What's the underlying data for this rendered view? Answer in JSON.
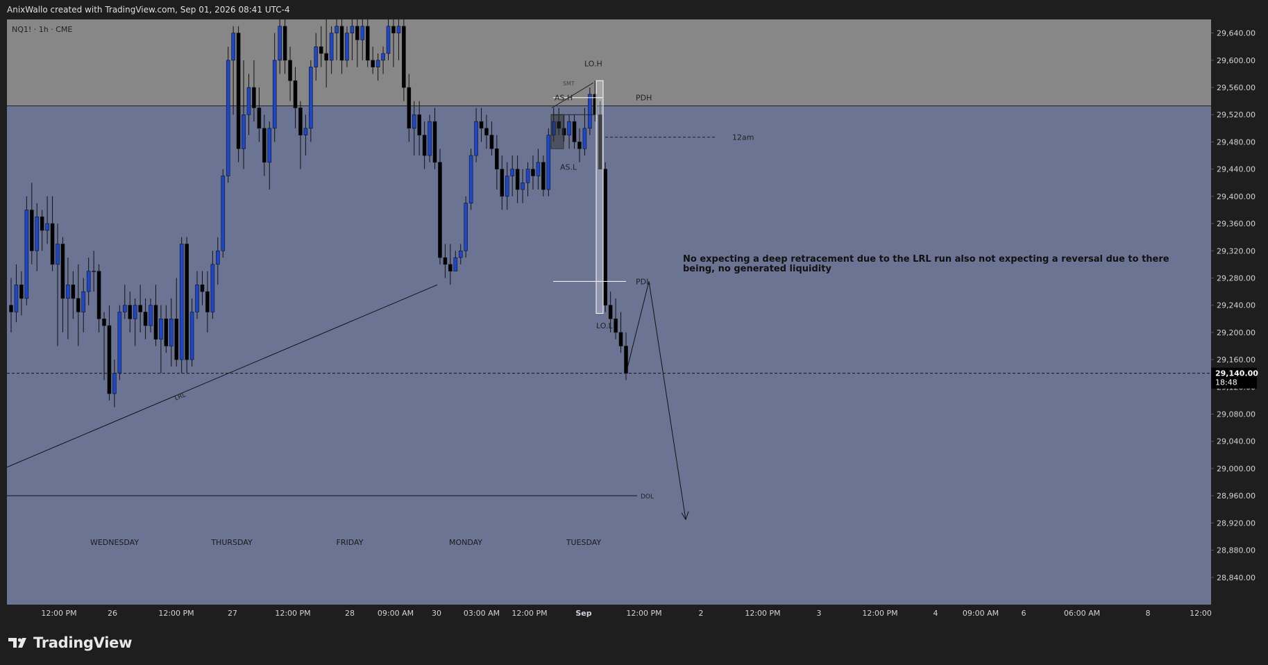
{
  "header": {
    "title": "AnixWallo created with TradingView.com, Sep 01, 2026 08:41 UTC-4"
  },
  "symbol": "NQ1! · 1h · CME",
  "brand": "TradingView",
  "annotation": "No expecting a deep retracement due to the LRL run also not expecting a reversal due to there being, no generated liquidity",
  "colors": {
    "background_pane": "#6b7593",
    "premium_zone": "#878787",
    "candle_up": "#1e46c8",
    "candle_down": "#000000",
    "axis_bg": "#1e1e1e",
    "price_tag": "#000000"
  },
  "chart_data": {
    "type": "candlestick",
    "ylim": [
      28800,
      29660
    ],
    "price_ticks": [
      "29,640.00",
      "29,600.00",
      "29,560.00",
      "29,520.00",
      "29,480.00",
      "29,440.00",
      "29,400.00",
      "29,360.00",
      "29,320.00",
      "29,280.00",
      "29,240.00",
      "29,200.00",
      "29,160.00",
      "29,120.00",
      "29,080.00",
      "29,040.00",
      "29,000.00",
      "28,960.00",
      "28,920.00",
      "28,880.00",
      "28,840.00"
    ],
    "time_ticks": [
      "12:00 PM",
      "26",
      "12:00 PM",
      "27",
      "12:00 PM",
      "28",
      "09:00 AM",
      "30",
      "03:00 AM",
      "12:00 PM",
      "Sep",
      "12:00 PM",
      "2",
      "12:00 PM",
      "3",
      "12:00 PM",
      "4",
      "09:00 AM",
      "6",
      "06:00 AM",
      "8",
      "12:00"
    ],
    "day_labels": [
      "WEDNESDAY",
      "THURSDAY",
      "FRIDAY",
      "MONDAY",
      "TUESDAY"
    ],
    "last_price": {
      "value": "29,140.00",
      "countdown": "18:48"
    },
    "levels": [
      {
        "name": "PDH",
        "label": "PDH",
        "price": 29545
      },
      {
        "name": "12am",
        "label": "12am",
        "price": 29487
      },
      {
        "name": "PDL",
        "label": "PDL",
        "price": 29275
      },
      {
        "name": "DOL",
        "label": "DOL",
        "price": 28960
      },
      {
        "name": "premium-line",
        "label": "",
        "price": 29533
      }
    ],
    "markers": [
      {
        "label": "LO.H",
        "price": 29595
      },
      {
        "label": "AS.H",
        "price": 29545
      },
      {
        "label": "AS.L",
        "price": 29443
      },
      {
        "label": "LO.L",
        "price": 29210
      },
      {
        "label": "SMT",
        "price": 29567
      },
      {
        "label": "LRL",
        "price": 29100
      }
    ],
    "candles": [
      [
        29240,
        29280,
        29200,
        29230
      ],
      [
        29230,
        29300,
        29215,
        29270
      ],
      [
        29270,
        29290,
        29225,
        29250
      ],
      [
        29250,
        29400,
        29240,
        29380
      ],
      [
        29380,
        29420,
        29300,
        29320
      ],
      [
        29320,
        29390,
        29290,
        29370
      ],
      [
        29370,
        29380,
        29320,
        29350
      ],
      [
        29350,
        29400,
        29330,
        29360
      ],
      [
        29360,
        29400,
        29290,
        29300
      ],
      [
        29300,
        29360,
        29180,
        29330
      ],
      [
        29330,
        29340,
        29200,
        29250
      ],
      [
        29250,
        29310,
        29190,
        29270
      ],
      [
        29270,
        29290,
        29220,
        29250
      ],
      [
        29250,
        29300,
        29180,
        29230
      ],
      [
        29230,
        29280,
        29200,
        29260
      ],
      [
        29260,
        29310,
        29240,
        29290
      ],
      [
        29290,
        29320,
        29260,
        29290
      ],
      [
        29290,
        29300,
        29200,
        29220
      ],
      [
        29220,
        29230,
        29130,
        29210
      ],
      [
        29210,
        29240,
        29100,
        29110
      ],
      [
        29110,
        29160,
        29090,
        29140
      ],
      [
        29140,
        29240,
        29130,
        29230
      ],
      [
        29230,
        29270,
        29220,
        29240
      ],
      [
        29240,
        29260,
        29200,
        29220
      ],
      [
        29220,
        29250,
        29180,
        29240
      ],
      [
        29240,
        29270,
        29200,
        29230
      ],
      [
        29230,
        29250,
        29190,
        29210
      ],
      [
        29210,
        29250,
        29200,
        29240
      ],
      [
        29240,
        29270,
        29180,
        29190
      ],
      [
        29190,
        29240,
        29140,
        29220
      ],
      [
        29220,
        29240,
        29170,
        29180
      ],
      [
        29180,
        29250,
        29150,
        29220
      ],
      [
        29220,
        29280,
        29150,
        29160
      ],
      [
        29160,
        29340,
        29140,
        29330
      ],
      [
        29330,
        29340,
        29140,
        29160
      ],
      [
        29160,
        29250,
        29150,
        29230
      ],
      [
        29230,
        29290,
        29220,
        29270
      ],
      [
        29270,
        29290,
        29240,
        29260
      ],
      [
        29260,
        29290,
        29200,
        29230
      ],
      [
        29230,
        29320,
        29220,
        29300
      ],
      [
        29300,
        29340,
        29270,
        29320
      ],
      [
        29320,
        29440,
        29310,
        29430
      ],
      [
        29430,
        29620,
        29420,
        29600
      ],
      [
        29600,
        29650,
        29520,
        29640
      ],
      [
        29640,
        29650,
        29450,
        29470
      ],
      [
        29470,
        29600,
        29440,
        29520
      ],
      [
        29520,
        29580,
        29490,
        29560
      ],
      [
        29560,
        29600,
        29510,
        29530
      ],
      [
        29530,
        29560,
        29480,
        29500
      ],
      [
        29500,
        29520,
        29430,
        29450
      ],
      [
        29450,
        29510,
        29410,
        29500
      ],
      [
        29500,
        29640,
        29480,
        29600
      ],
      [
        29600,
        29660,
        29580,
        29650
      ],
      [
        29650,
        29660,
        29580,
        29600
      ],
      [
        29600,
        29620,
        29540,
        29570
      ],
      [
        29570,
        29590,
        29500,
        29530
      ],
      [
        29530,
        29540,
        29440,
        29490
      ],
      [
        29490,
        29520,
        29460,
        29500
      ],
      [
        29500,
        29600,
        29480,
        29590
      ],
      [
        29590,
        29640,
        29570,
        29620
      ],
      [
        29620,
        29650,
        29590,
        29610
      ],
      [
        29610,
        29660,
        29560,
        29600
      ],
      [
        29600,
        29650,
        29580,
        29640
      ],
      [
        29640,
        29660,
        29600,
        29650
      ],
      [
        29650,
        29660,
        29580,
        29600
      ],
      [
        29600,
        29650,
        29590,
        29640
      ],
      [
        29640,
        29660,
        29600,
        29650
      ],
      [
        29650,
        29660,
        29590,
        29630
      ],
      [
        29630,
        29660,
        29600,
        29650
      ],
      [
        29650,
        29660,
        29590,
        29600
      ],
      [
        29600,
        29620,
        29580,
        29590
      ],
      [
        29590,
        29610,
        29570,
        29600
      ],
      [
        29600,
        29620,
        29580,
        29610
      ],
      [
        29610,
        29660,
        29600,
        29650
      ],
      [
        29650,
        29660,
        29590,
        29640
      ],
      [
        29640,
        29660,
        29600,
        29650
      ],
      [
        29650,
        29660,
        29540,
        29560
      ],
      [
        29560,
        29580,
        29480,
        29500
      ],
      [
        29500,
        29540,
        29460,
        29520
      ],
      [
        29520,
        29540,
        29460,
        29490
      ],
      [
        29490,
        29510,
        29440,
        29460
      ],
      [
        29460,
        29520,
        29450,
        29510
      ],
      [
        29510,
        29530,
        29440,
        29450
      ],
      [
        29450,
        29470,
        29300,
        29310
      ],
      [
        29310,
        29330,
        29280,
        29300
      ],
      [
        29300,
        29330,
        29270,
        29290
      ],
      [
        29290,
        29320,
        29290,
        29310
      ],
      [
        29310,
        29330,
        29300,
        29320
      ],
      [
        29320,
        29400,
        29310,
        29390
      ],
      [
        29390,
        29470,
        29380,
        29460
      ],
      [
        29460,
        29530,
        29450,
        29510
      ],
      [
        29510,
        29530,
        29480,
        29500
      ],
      [
        29500,
        29520,
        29470,
        29490
      ],
      [
        29490,
        29510,
        29460,
        29470
      ],
      [
        29470,
        29490,
        29410,
        29440
      ],
      [
        29440,
        29460,
        29380,
        29400
      ],
      [
        29400,
        29450,
        29380,
        29430
      ],
      [
        29430,
        29460,
        29400,
        29440
      ],
      [
        29440,
        29460,
        29390,
        29410
      ],
      [
        29410,
        29440,
        29390,
        29420
      ],
      [
        29420,
        29450,
        29400,
        29440
      ],
      [
        29440,
        29460,
        29410,
        29430
      ],
      [
        29430,
        29470,
        29410,
        29450
      ],
      [
        29450,
        29460,
        29400,
        29410
      ],
      [
        29410,
        29500,
        29400,
        29490
      ],
      [
        29490,
        29530,
        29480,
        29510
      ],
      [
        29510,
        29530,
        29490,
        29500
      ],
      [
        29500,
        29520,
        29480,
        29490
      ],
      [
        29490,
        29520,
        29470,
        29510
      ],
      [
        29510,
        29520,
        29470,
        29480
      ],
      [
        29480,
        29500,
        29450,
        29470
      ],
      [
        29470,
        29530,
        29460,
        29500
      ],
      [
        29500,
        29560,
        29490,
        29550
      ],
      [
        29550,
        29570,
        29510,
        29520
      ],
      [
        29520,
        29540,
        29460,
        29440
      ],
      [
        29440,
        29450,
        29230,
        29240
      ],
      [
        29240,
        29260,
        29200,
        29220
      ],
      [
        29220,
        29250,
        29190,
        29200
      ],
      [
        29200,
        29230,
        29170,
        29180
      ],
      [
        29180,
        29200,
        29130,
        29140
      ]
    ]
  }
}
